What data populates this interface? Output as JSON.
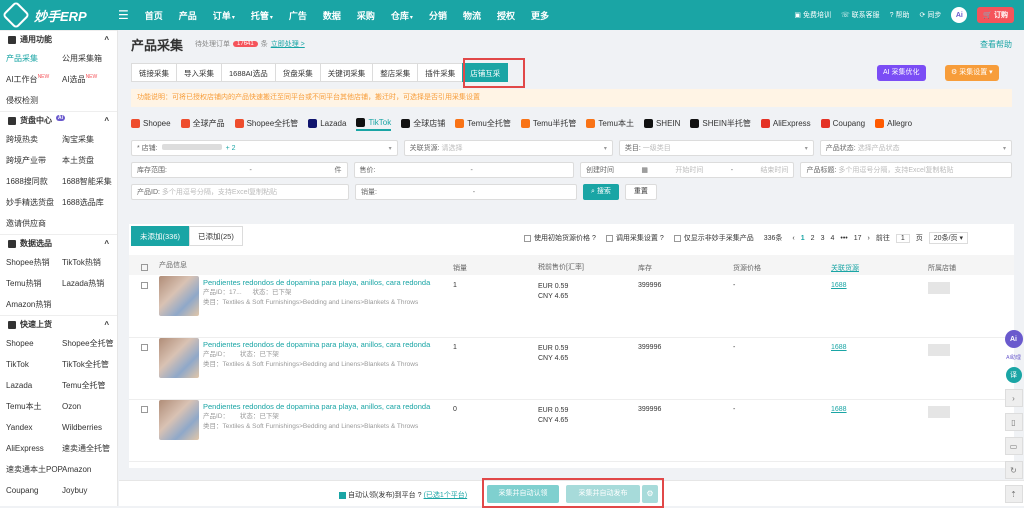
{
  "app": {
    "logo_text": "妙手ERP"
  },
  "topnav": {
    "items": [
      {
        "label": "首页",
        "caret": false
      },
      {
        "label": "产品",
        "caret": false
      },
      {
        "label": "订单",
        "caret": true
      },
      {
        "label": "托管",
        "caret": true
      },
      {
        "label": "广告",
        "caret": false
      },
      {
        "label": "数据",
        "caret": false
      },
      {
        "label": "采购",
        "caret": false
      },
      {
        "label": "仓库",
        "caret": true
      },
      {
        "label": "分销",
        "caret": false
      },
      {
        "label": "物流",
        "caret": false
      },
      {
        "label": "授权",
        "caret": false
      },
      {
        "label": "更多",
        "caret": false
      }
    ],
    "right": {
      "training": "免费培训",
      "contact": "联系客服",
      "help": "帮助",
      "sync": "同步",
      "ai": "Ai",
      "order": "订购"
    }
  },
  "sidebar": {
    "sections": [
      {
        "title": "通用功能",
        "items": [
          {
            "label": "产品采集",
            "active": true
          },
          {
            "label": "公用采集箱"
          },
          {
            "label": "AI工作台",
            "new": "NEW"
          },
          {
            "label": "AI选品",
            "new": "NEW"
          },
          {
            "label": "侵权检测"
          }
        ]
      },
      {
        "title": "货盘中心",
        "badge": "Ai",
        "items": [
          {
            "label": "跨境热卖"
          },
          {
            "label": "淘宝采集"
          },
          {
            "label": "跨境产业带"
          },
          {
            "label": "本土货盘"
          },
          {
            "label": "1688搜同款"
          },
          {
            "label": "1688智能采集"
          },
          {
            "label": "妙手精选货盘"
          },
          {
            "label": "1688选品库"
          },
          {
            "label": "邀请供应商"
          }
        ]
      },
      {
        "title": "数据选品",
        "items": [
          {
            "label": "Shopee热销"
          },
          {
            "label": "TikTok热销"
          },
          {
            "label": "Temu热销"
          },
          {
            "label": "Lazada热销"
          },
          {
            "label": "Amazon热销"
          }
        ]
      },
      {
        "title": "快速上货",
        "items": [
          {
            "label": "Shopee"
          },
          {
            "label": "Shopee全托管"
          },
          {
            "label": "TikTok"
          },
          {
            "label": "TikTok全托管"
          },
          {
            "label": "Lazada"
          },
          {
            "label": "Temu全托管"
          },
          {
            "label": "Temu本土"
          },
          {
            "label": "Ozon"
          },
          {
            "label": "Yandex"
          },
          {
            "label": "Wildberries"
          },
          {
            "label": "AliExpress"
          },
          {
            "label": "速卖通全托管"
          },
          {
            "label": "速卖通本土POP"
          },
          {
            "label": "Amazon"
          },
          {
            "label": "Coupang"
          },
          {
            "label": "Joybuy"
          }
        ]
      }
    ]
  },
  "header": {
    "title": "产品采集",
    "pending_label": "待处理订单",
    "pending_count": "17641",
    "pending_unit": "条",
    "pending_link": "立即处理 >",
    "help": "查看帮助"
  },
  "tabs": [
    {
      "label": "链接采集"
    },
    {
      "label": "导入采集"
    },
    {
      "label": "1688AI选品"
    },
    {
      "label": "货盘采集"
    },
    {
      "label": "关键词采集"
    },
    {
      "label": "整店采集"
    },
    {
      "label": "插件采集"
    },
    {
      "label": "店铺互采",
      "active": true
    }
  ],
  "actions": {
    "ai_optimize": "AI 采集优化",
    "collect_settings": "采集设置"
  },
  "notice": "功能说明：可将已授权店铺内的产品快速搬迁至同平台或不同平台其他店铺，搬迁时，可选择是否引用采集设置",
  "platforms": [
    {
      "label": "Shopee",
      "color": "#ee4d2d"
    },
    {
      "label": "全球产品",
      "color": "#ee4d2d"
    },
    {
      "label": "Shopee全托管",
      "color": "#ee4d2d"
    },
    {
      "label": "Lazada",
      "color": "#0f146d"
    },
    {
      "label": "TikTok",
      "color": "#111111",
      "active": true
    },
    {
      "label": "全球店铺",
      "color": "#111111"
    },
    {
      "label": "Temu全托管",
      "color": "#f97316"
    },
    {
      "label": "Temu半托管",
      "color": "#f97316"
    },
    {
      "label": "Temu本土",
      "color": "#f97316"
    },
    {
      "label": "SHEIN",
      "color": "#111111"
    },
    {
      "label": "SHEIN半托管",
      "color": "#111111"
    },
    {
      "label": "AliExpress",
      "color": "#e43225"
    },
    {
      "label": "Coupang",
      "color": "#e43225"
    },
    {
      "label": "Allegro",
      "color": "#ff5a00"
    }
  ],
  "filters": {
    "shop_label": "* 店铺:",
    "shop_more": "+ 2",
    "related_source_label": "关联货源:",
    "related_source_ph": "请选择",
    "category_label": "类目:",
    "category_ph": "一级类目",
    "status_label": "产品状态:",
    "status_ph": "选择产品状态",
    "stock_label": "库存范围:",
    "stock_dash": "-",
    "stock_unit": "件",
    "price_label": "售价:",
    "price_dash": "-",
    "create_time_label": "创建时间",
    "start_ph": "开始时间",
    "end_ph": "结束时间",
    "title_label": "产品标题:",
    "title_ph": "多个用逗号分隔，支持Excel复制粘贴",
    "id_label": "产品ID:",
    "id_ph": "多个用逗号分隔，支持Excel复制粘贴",
    "sales_label": "销量:",
    "sales_dash": "-",
    "search_btn": "搜索",
    "reset_btn": "重置"
  },
  "list": {
    "tab_not_added": "未添加(336)",
    "tab_added": "已添加(25)",
    "opt_init_price": "使用初始货源价格",
    "opt_collect_setting": "调用采集设置",
    "opt_only_unpicked": "仅显示非妙手采集产品",
    "total": "336条",
    "pages": [
      "1",
      "2",
      "3",
      "4",
      "•••",
      "17"
    ],
    "goto_label": "前往",
    "goto_value": "1",
    "goto_unit": "页",
    "page_size": "20条/页",
    "columns": [
      "产品信息",
      "销量",
      "税前售价[汇率]",
      "库存",
      "货源价格",
      "关联货源",
      "所属店铺"
    ],
    "rows": [
      {
        "title": "Pendientes redondos de dopamina para playa, anillos, cara redonda",
        "id_label": "产品ID：17...",
        "status": "状态：已下架",
        "category": "类目：Textiles & Soft Furnishings>Bedding and Linens>Blankets & Throws",
        "sales": "1",
        "price_eur": "EUR 0.59",
        "price_cny": "CNY 4.65",
        "stock": "399996",
        "source_price": "-",
        "source": "1688"
      },
      {
        "title": "Pendientes redondos de dopamina para playa, anillos, cara redonda",
        "id_label": "产品ID：",
        "status": "状态：已下架",
        "category": "类目：Textiles & Soft Furnishings>Bedding and Linens>Blankets & Throws",
        "sales": "1",
        "price_eur": "EUR 0.59",
        "price_cny": "CNY 4.65",
        "stock": "399996",
        "source_price": "-",
        "source": "1688"
      },
      {
        "title": "Pendientes redondos de dopamina para playa, anillos, cara redonda",
        "id_label": "产品ID：",
        "status": "状态：已下架",
        "category": "类目：Textiles & Soft Furnishings>Bedding and Linens>Blankets & Throws",
        "sales": "0",
        "price_eur": "EUR 0.59",
        "price_cny": "CNY 4.65",
        "stock": "399996",
        "source_price": "-",
        "source": "1688"
      }
    ]
  },
  "bottom": {
    "auto_claim": "自动认领(发布)到平台",
    "selected_platforms": "(已选1个平台)",
    "btn_claim": "采集并自动认领",
    "btn_publish": "采集并自动发布"
  },
  "right_tools": {
    "ai": "Ai",
    "ai_label": "AI助理",
    "translate": "译"
  }
}
